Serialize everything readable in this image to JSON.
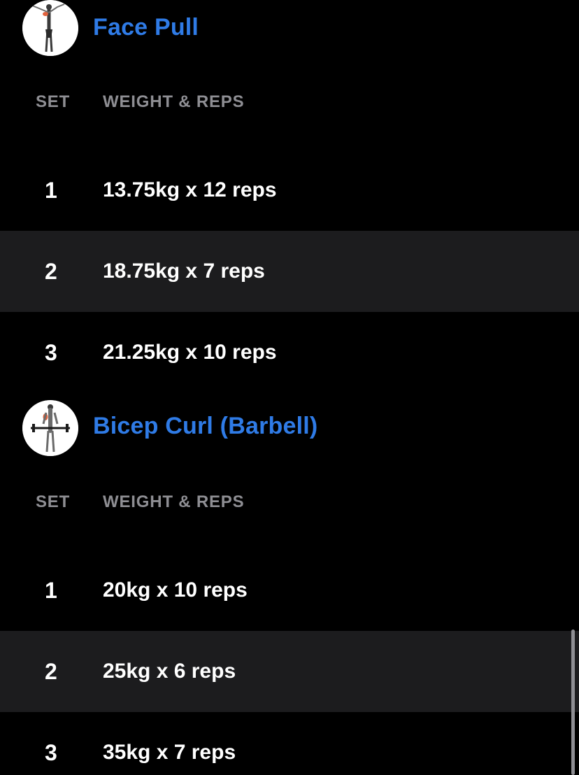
{
  "colors": {
    "accent": "#2f7be6",
    "background": "#000000",
    "alt_row": "#1c1c1e",
    "header_text": "#8e8e93",
    "text": "#ffffff"
  },
  "exercises": [
    {
      "name": "Face Pull",
      "icon": "face-pull-figure-icon",
      "col_set": "SET",
      "col_weight": "WEIGHT & REPS",
      "sets": [
        {
          "number": "1",
          "value": "13.75kg x 12 reps"
        },
        {
          "number": "2",
          "value": "18.75kg x 7 reps"
        },
        {
          "number": "3",
          "value": "21.25kg x 10 reps"
        }
      ]
    },
    {
      "name": "Bicep Curl (Barbell)",
      "icon": "bicep-curl-figure-icon",
      "col_set": "SET",
      "col_weight": "WEIGHT & REPS",
      "sets": [
        {
          "number": "1",
          "value": "20kg x 10 reps"
        },
        {
          "number": "2",
          "value": "25kg x 6 reps"
        },
        {
          "number": "3",
          "value": "35kg x 7 reps"
        }
      ]
    }
  ]
}
